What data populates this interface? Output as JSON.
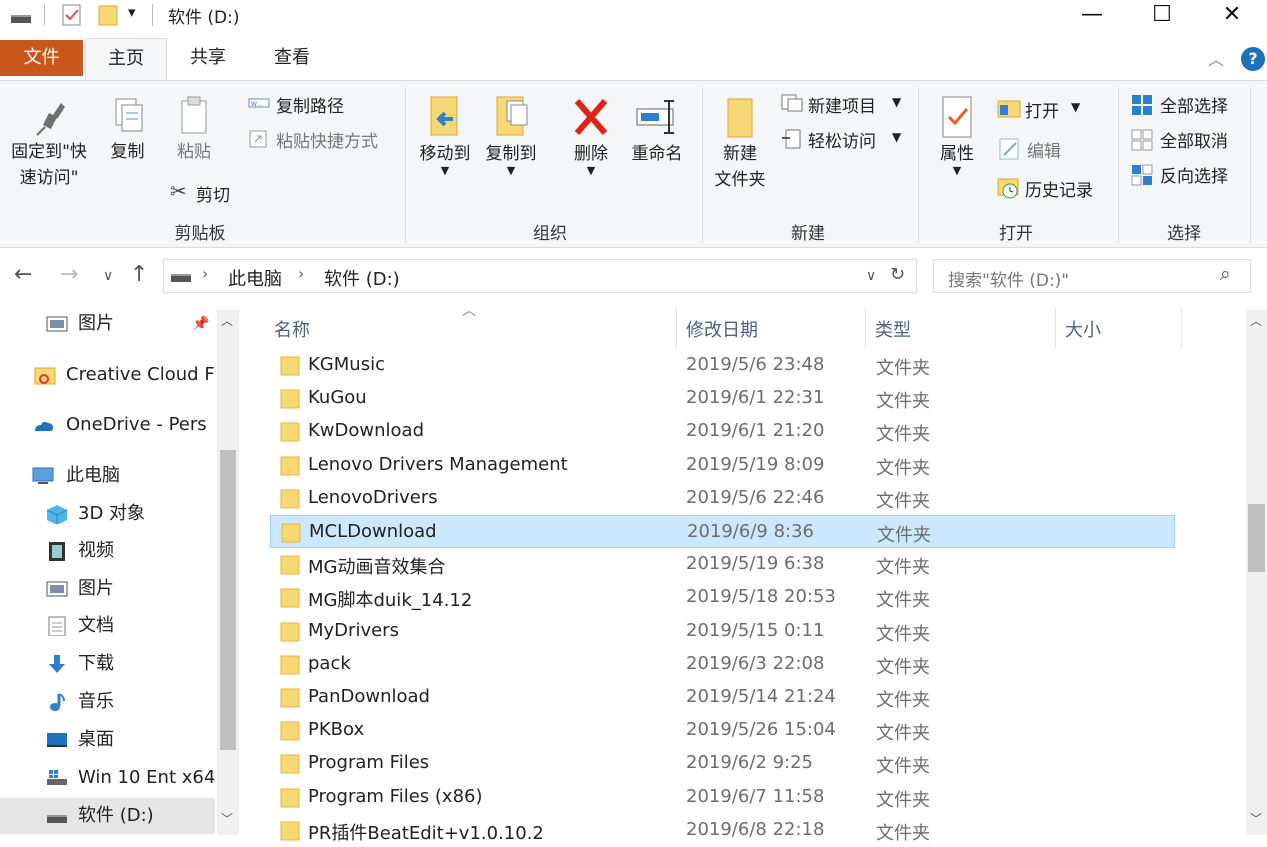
{
  "window": {
    "title": "软件 (D:)",
    "controls": {
      "minimize": "—",
      "maximize": "☐",
      "close": "✕"
    }
  },
  "tabs": {
    "file": "文件",
    "home": "主页",
    "share": "共享",
    "view": "查看"
  },
  "ribbon": {
    "pin": "固定到\"快速访问\"",
    "pin_line1": "固定到\"快",
    "pin_line2": "速访问\"",
    "copy": "复制",
    "paste": "粘贴",
    "copy_path": "复制路径",
    "paste_shortcut": "粘贴快捷方式",
    "cut": "剪切",
    "clipboard_group": "剪贴板",
    "move_to": "移动到",
    "copy_to": "复制到",
    "delete": "删除",
    "rename": "重命名",
    "organize_group": "组织",
    "new_folder_line1": "新建",
    "new_folder_line2": "文件夹",
    "new_item": "新建项目",
    "easy_access": "轻松访问",
    "new_group": "新建",
    "properties": "属性",
    "open": "打开",
    "edit": "编辑",
    "history": "历史记录",
    "open_group": "打开",
    "select_all": "全部选择",
    "select_none": "全部取消",
    "invert_selection": "反向选择",
    "select_group": "选择"
  },
  "address": {
    "crumbs": [
      "此电脑",
      "软件 (D:)"
    ],
    "search_placeholder": "搜索\"软件 (D:)\""
  },
  "nav": {
    "items": [
      {
        "label": "图片",
        "icon": "pictures-icon"
      },
      {
        "label": "Creative Cloud F",
        "icon": "creative-cloud-icon"
      },
      {
        "label": "OneDrive - Pers",
        "icon": "onedrive-icon"
      },
      {
        "label": "此电脑",
        "icon": "computer-icon"
      },
      {
        "label": "3D 对象",
        "icon": "3d-objects-icon"
      },
      {
        "label": "视频",
        "icon": "videos-icon"
      },
      {
        "label": "图片",
        "icon": "pictures-icon"
      },
      {
        "label": "文档",
        "icon": "documents-icon"
      },
      {
        "label": "下载",
        "icon": "downloads-icon"
      },
      {
        "label": "音乐",
        "icon": "music-icon"
      },
      {
        "label": "桌面",
        "icon": "desktop-icon"
      },
      {
        "label": "Win 10 Ent x64",
        "icon": "drive-c-icon"
      },
      {
        "label": "软件 (D:)",
        "icon": "drive-d-icon"
      }
    ]
  },
  "columns": {
    "name": "名称",
    "modified": "修改日期",
    "type": "类型",
    "size": "大小"
  },
  "files": [
    {
      "name": "KGMusic",
      "modified": "2019/5/6 23:48",
      "type": "文件夹"
    },
    {
      "name": "KuGou",
      "modified": "2019/6/1 22:31",
      "type": "文件夹"
    },
    {
      "name": "KwDownload",
      "modified": "2019/6/1 21:20",
      "type": "文件夹"
    },
    {
      "name": "Lenovo Drivers Management",
      "modified": "2019/5/19 8:09",
      "type": "文件夹"
    },
    {
      "name": "LenovoDrivers",
      "modified": "2019/5/6 22:46",
      "type": "文件夹"
    },
    {
      "name": "MCLDownload",
      "modified": "2019/6/9 8:36",
      "type": "文件夹"
    },
    {
      "name": "MG动画音效集合",
      "modified": "2019/5/19 6:38",
      "type": "文件夹"
    },
    {
      "name": "MG脚本duik_14.12",
      "modified": "2019/5/18 20:53",
      "type": "文件夹"
    },
    {
      "name": "MyDrivers",
      "modified": "2019/5/15 0:11",
      "type": "文件夹"
    },
    {
      "name": "pack",
      "modified": "2019/6/3 22:08",
      "type": "文件夹"
    },
    {
      "name": "PanDownload",
      "modified": "2019/5/14 21:24",
      "type": "文件夹"
    },
    {
      "name": "PKBox",
      "modified": "2019/5/26 15:04",
      "type": "文件夹"
    },
    {
      "name": "Program Files",
      "modified": "2019/6/2 9:25",
      "type": "文件夹"
    },
    {
      "name": "Program Files (x86)",
      "modified": "2019/6/7 11:58",
      "type": "文件夹"
    },
    {
      "name": "PR插件BeatEdit+v1.0.10.2",
      "modified": "2019/6/8 22:18",
      "type": "文件夹"
    }
  ],
  "colors": {
    "file_tab": "#c8571c",
    "selection": "#cce8ff",
    "folder": "#f8d775"
  }
}
